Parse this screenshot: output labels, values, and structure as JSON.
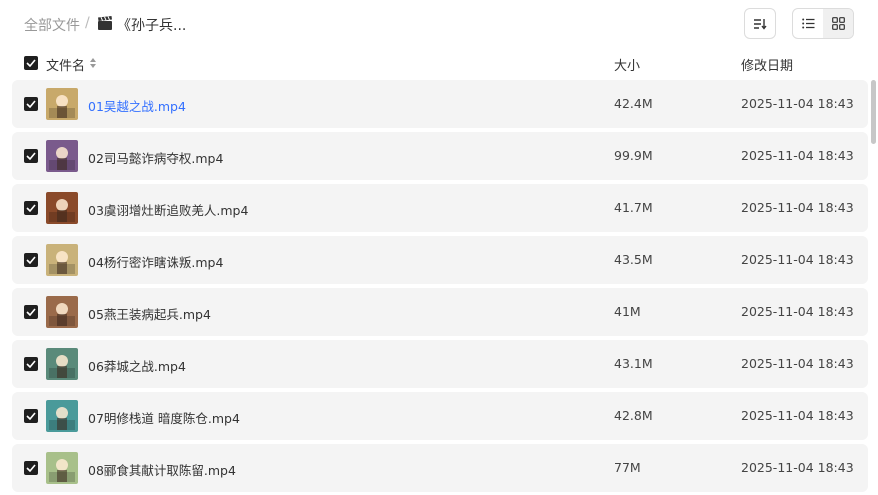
{
  "breadcrumb": {
    "root": "全部文件",
    "separator": "/",
    "current": "《孙子兵...",
    "folder_icon": "clapperboard-icon"
  },
  "toolbar": {
    "sort_icon": "sort-icon",
    "list_view_icon": "list-view-icon",
    "grid_view_icon": "grid-view-icon",
    "active_view": "list"
  },
  "table": {
    "headers": {
      "name": "文件名",
      "size": "大小",
      "date": "修改日期"
    },
    "rows": [
      {
        "name": "01吴越之战.mp4",
        "size": "42.4M",
        "date": "2025-11-04 18:43",
        "highlighted": true,
        "thumb_color": "#c8a96a"
      },
      {
        "name": "02司马懿诈病夺权.mp4",
        "size": "99.9M",
        "date": "2025-11-04 18:43",
        "highlighted": false,
        "thumb_color": "#7a5a8c"
      },
      {
        "name": "03虞诩增灶断追败羌人.mp4",
        "size": "41.7M",
        "date": "2025-11-04 18:43",
        "highlighted": false,
        "thumb_color": "#8a4a2a"
      },
      {
        "name": "04杨行密诈瞎诛叛.mp4",
        "size": "43.5M",
        "date": "2025-11-04 18:43",
        "highlighted": false,
        "thumb_color": "#c9b27a"
      },
      {
        "name": "05燕王装病起兵.mp4",
        "size": "41M",
        "date": "2025-11-04 18:43",
        "highlighted": false,
        "thumb_color": "#9a6a4a"
      },
      {
        "name": "06莽城之战.mp4",
        "size": "43.1M",
        "date": "2025-11-04 18:43",
        "highlighted": false,
        "thumb_color": "#5a8a7a"
      },
      {
        "name": "07明修栈道 暗度陈仓.mp4",
        "size": "42.8M",
        "date": "2025-11-04 18:43",
        "highlighted": false,
        "thumb_color": "#4a9a9a"
      },
      {
        "name": "08郦食其献计取陈留.mp4",
        "size": "77M",
        "date": "2025-11-04 18:43",
        "highlighted": false,
        "thumb_color": "#a8c08a"
      }
    ]
  },
  "colors": {
    "link": "#3370ff",
    "row_bg": "#f4f4f4",
    "checkbox": "#1f1f1f"
  }
}
